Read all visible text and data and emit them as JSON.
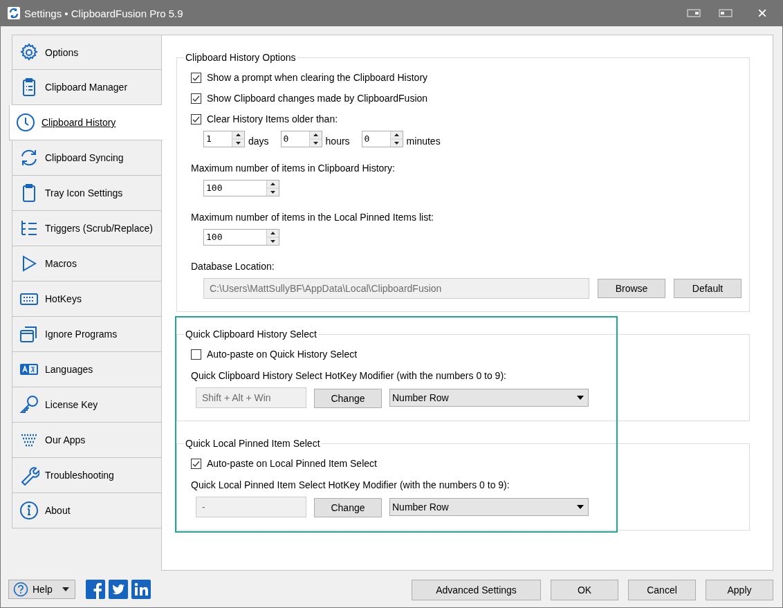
{
  "window": {
    "title": "Settings • ClipboardFusion Pro 5.9",
    "close": "×"
  },
  "sidebar": {
    "items": [
      {
        "label": "Options",
        "selected": false
      },
      {
        "label": "Clipboard Manager",
        "selected": false
      },
      {
        "label": "Clipboard History",
        "selected": true
      },
      {
        "label": "Clipboard Syncing",
        "selected": false
      },
      {
        "label": "Tray Icon Settings",
        "selected": false
      },
      {
        "label": "Triggers (Scrub/Replace)",
        "selected": false
      },
      {
        "label": "Macros",
        "selected": false
      },
      {
        "label": "HotKeys",
        "selected": false
      },
      {
        "label": "Ignore Programs",
        "selected": false
      },
      {
        "label": "Languages",
        "selected": false
      },
      {
        "label": "License Key",
        "selected": false
      },
      {
        "label": "Our Apps",
        "selected": false
      },
      {
        "label": "Troubleshooting",
        "selected": false
      },
      {
        "label": "About",
        "selected": false
      }
    ]
  },
  "history_options": {
    "title": "Clipboard History Options",
    "checkboxes": [
      {
        "label": "Show a prompt when clearing the Clipboard History",
        "checked": true
      },
      {
        "label": "Show Clipboard changes made by ClipboardFusion",
        "checked": true
      },
      {
        "label": "Clear History Items older than:",
        "checked": true
      }
    ],
    "age_fields": [
      {
        "value": "1",
        "unit": "days"
      },
      {
        "value": "0",
        "unit": "hours"
      },
      {
        "value": "0",
        "unit": "minutes"
      }
    ],
    "max_history": {
      "label": "Maximum number of items in Clipboard History:",
      "value": "100"
    },
    "max_pinned": {
      "label": "Maximum number of items in the Local Pinned Items list:",
      "value": "100"
    },
    "database": {
      "label": "Database Location:",
      "value": "C:\\Users\\MattSullyBF\\AppData\\Local\\ClipboardFusion",
      "disabled": true,
      "buttons": [
        "Browse",
        "Default"
      ]
    }
  },
  "quick_groups": [
    {
      "title": "Quick Clipboard History Select",
      "auto_paste": {
        "label": "Auto-paste on Quick History Select",
        "checked": false
      },
      "modifier_label": "Quick Clipboard History Select HotKey Modifier (with the numbers 0 to 9):",
      "modifier_value": "Shift + Alt + Win",
      "modifier_disabled": true,
      "change_button": "Change",
      "dropdown": "Number Row"
    },
    {
      "title": "Quick Local Pinned Item Select",
      "auto_paste": {
        "label": "Auto-paste on Local Pinned Item Select",
        "checked": true
      },
      "modifier_label": "Quick Local Pinned Item Select HotKey Modifier (with the numbers 0 to 9):",
      "modifier_value": "-",
      "modifier_disabled": true,
      "change_button": "Change",
      "dropdown": "Number Row"
    }
  ],
  "footer": {
    "help": "Help",
    "buttons": [
      "Advanced Settings",
      "OK",
      "Cancel",
      "Apply"
    ]
  }
}
